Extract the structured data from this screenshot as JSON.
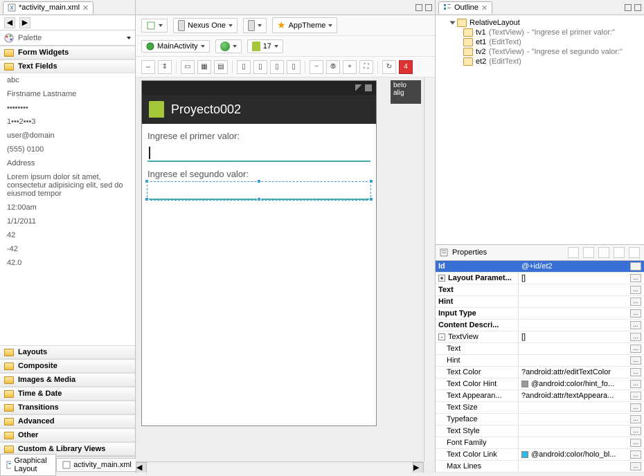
{
  "tab": {
    "file": "*activity_main.xml"
  },
  "nav": {
    "palette_label": "Palette",
    "palette_icon_name": "palette-icon"
  },
  "palette": {
    "sections_top": [
      {
        "label": "Form Widgets"
      },
      {
        "label": "Text Fields"
      }
    ],
    "items": [
      "abc",
      "Firstname Lastname",
      "••••••••",
      "1•••2•••3",
      "user@domain",
      "(555) 0100",
      "Address",
      "Lorem ipsum dolor sit amet, consectetur adipisicing elit, sed do eiusmod tempor",
      "12:00am",
      "1/1/2011",
      "42",
      "-42",
      "42.0"
    ],
    "sections_bottom": [
      "Layouts",
      "Composite",
      "Images & Media",
      "Time & Date",
      "Transitions",
      "Advanced",
      "Other",
      "Custom & Library Views"
    ]
  },
  "bottom_tabs": {
    "graphical": "Graphical Layout",
    "xml": "activity_main.xml"
  },
  "toolbar1": {
    "device": "Nexus One",
    "theme": "AppTheme"
  },
  "toolbar2": {
    "activity": "MainActivity",
    "api": "17"
  },
  "iconbar_badge": "4",
  "hint_panel": "belo\nalig",
  "device_preview": {
    "app_title": "Proyecto002",
    "tv1": "Ingrese el primer valor:",
    "tv2": "Ingrese el segundo valor:"
  },
  "outline": {
    "title": "Outline",
    "root": "RelativeLayout",
    "children": [
      {
        "id": "tv1",
        "type": "(TextView)",
        "hint": "- \"Ingrese el primer valor:\""
      },
      {
        "id": "et1",
        "type": "(EditText)",
        "hint": ""
      },
      {
        "id": "tv2",
        "type": "(TextView)",
        "hint": "- \"Ingrese el segundo valor:\""
      },
      {
        "id": "et2",
        "type": "(EditText)",
        "hint": ""
      }
    ]
  },
  "properties": {
    "title": "Properties",
    "rows": [
      {
        "k": "Id",
        "v": "@+id/et2",
        "sel": true,
        "bold": true
      },
      {
        "k": "Layout Paramet...",
        "v": "[]",
        "bold": true,
        "exp": "+"
      },
      {
        "k": "Text",
        "v": "",
        "bold": true
      },
      {
        "k": "Hint",
        "v": "",
        "bold": true
      },
      {
        "k": "Input Type",
        "v": "",
        "bold": true
      },
      {
        "k": "Content Descri...",
        "v": "",
        "bold": true
      },
      {
        "k": "TextView",
        "v": "[]",
        "exp": "-"
      },
      {
        "k": "Text",
        "v": "",
        "indent": true
      },
      {
        "k": "Hint",
        "v": "",
        "indent": true
      },
      {
        "k": "Text Color",
        "v": "?android:attr/editTextColor",
        "indent": true
      },
      {
        "k": "Text Color Hint",
        "v": "@android:color/hint_fo...",
        "indent": true,
        "swatch": "#9a9a9a"
      },
      {
        "k": "Text Appearan...",
        "v": "?android:attr/textAppeara...",
        "indent": true
      },
      {
        "k": "Text Size",
        "v": "",
        "indent": true
      },
      {
        "k": "Typeface",
        "v": "",
        "indent": true
      },
      {
        "k": "Text Style",
        "v": "",
        "indent": true
      },
      {
        "k": "Font Family",
        "v": "",
        "indent": true
      },
      {
        "k": "Text Color Link",
        "v": "@android:color/holo_bl...",
        "indent": true,
        "swatch": "#33b5e5"
      },
      {
        "k": "Max Lines",
        "v": "",
        "indent": true
      }
    ]
  }
}
